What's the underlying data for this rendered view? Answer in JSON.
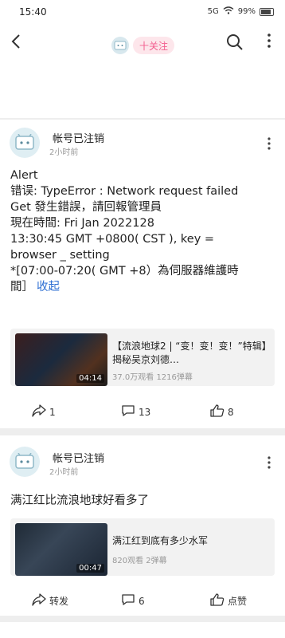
{
  "status_bar": {
    "time": "15:40",
    "signal": "5G",
    "battery": "99%"
  },
  "header": {
    "follow_label": "十关注"
  },
  "posts": [
    {
      "user": "帐号已注销",
      "time": "2小时前",
      "lines": [
        "Alert",
        "错误:   TypeError : Network request failed",
        "Get 發生錯誤，請回報管理員",
        "現在時間:   Fri Jan 2022128",
        "13:30:45 GMT +0800( CST ), key =",
        "browser _ setting",
        "*[07:00-07:20( GMT +8）為伺服器維護時",
        "間］"
      ],
      "collapse": "收起",
      "video": {
        "title": "【流浪地球2 | “变！变！变！”特辑】揭秘吴京刘德…",
        "stats": "37.0万观看 1216弹幕",
        "duration": "04:14"
      },
      "actions": {
        "share": "1",
        "comment": "13",
        "like": "8"
      }
    },
    {
      "user": "帐号已注销",
      "time": "2小时前",
      "text": "满江红比流浪地球好看多了",
      "video": {
        "title": "满江红到底有多少水军",
        "stats": "820观看 2弹幕",
        "duration": "00:47"
      },
      "actions": {
        "share": "转发",
        "comment": "6",
        "like": "点赞"
      }
    }
  ]
}
